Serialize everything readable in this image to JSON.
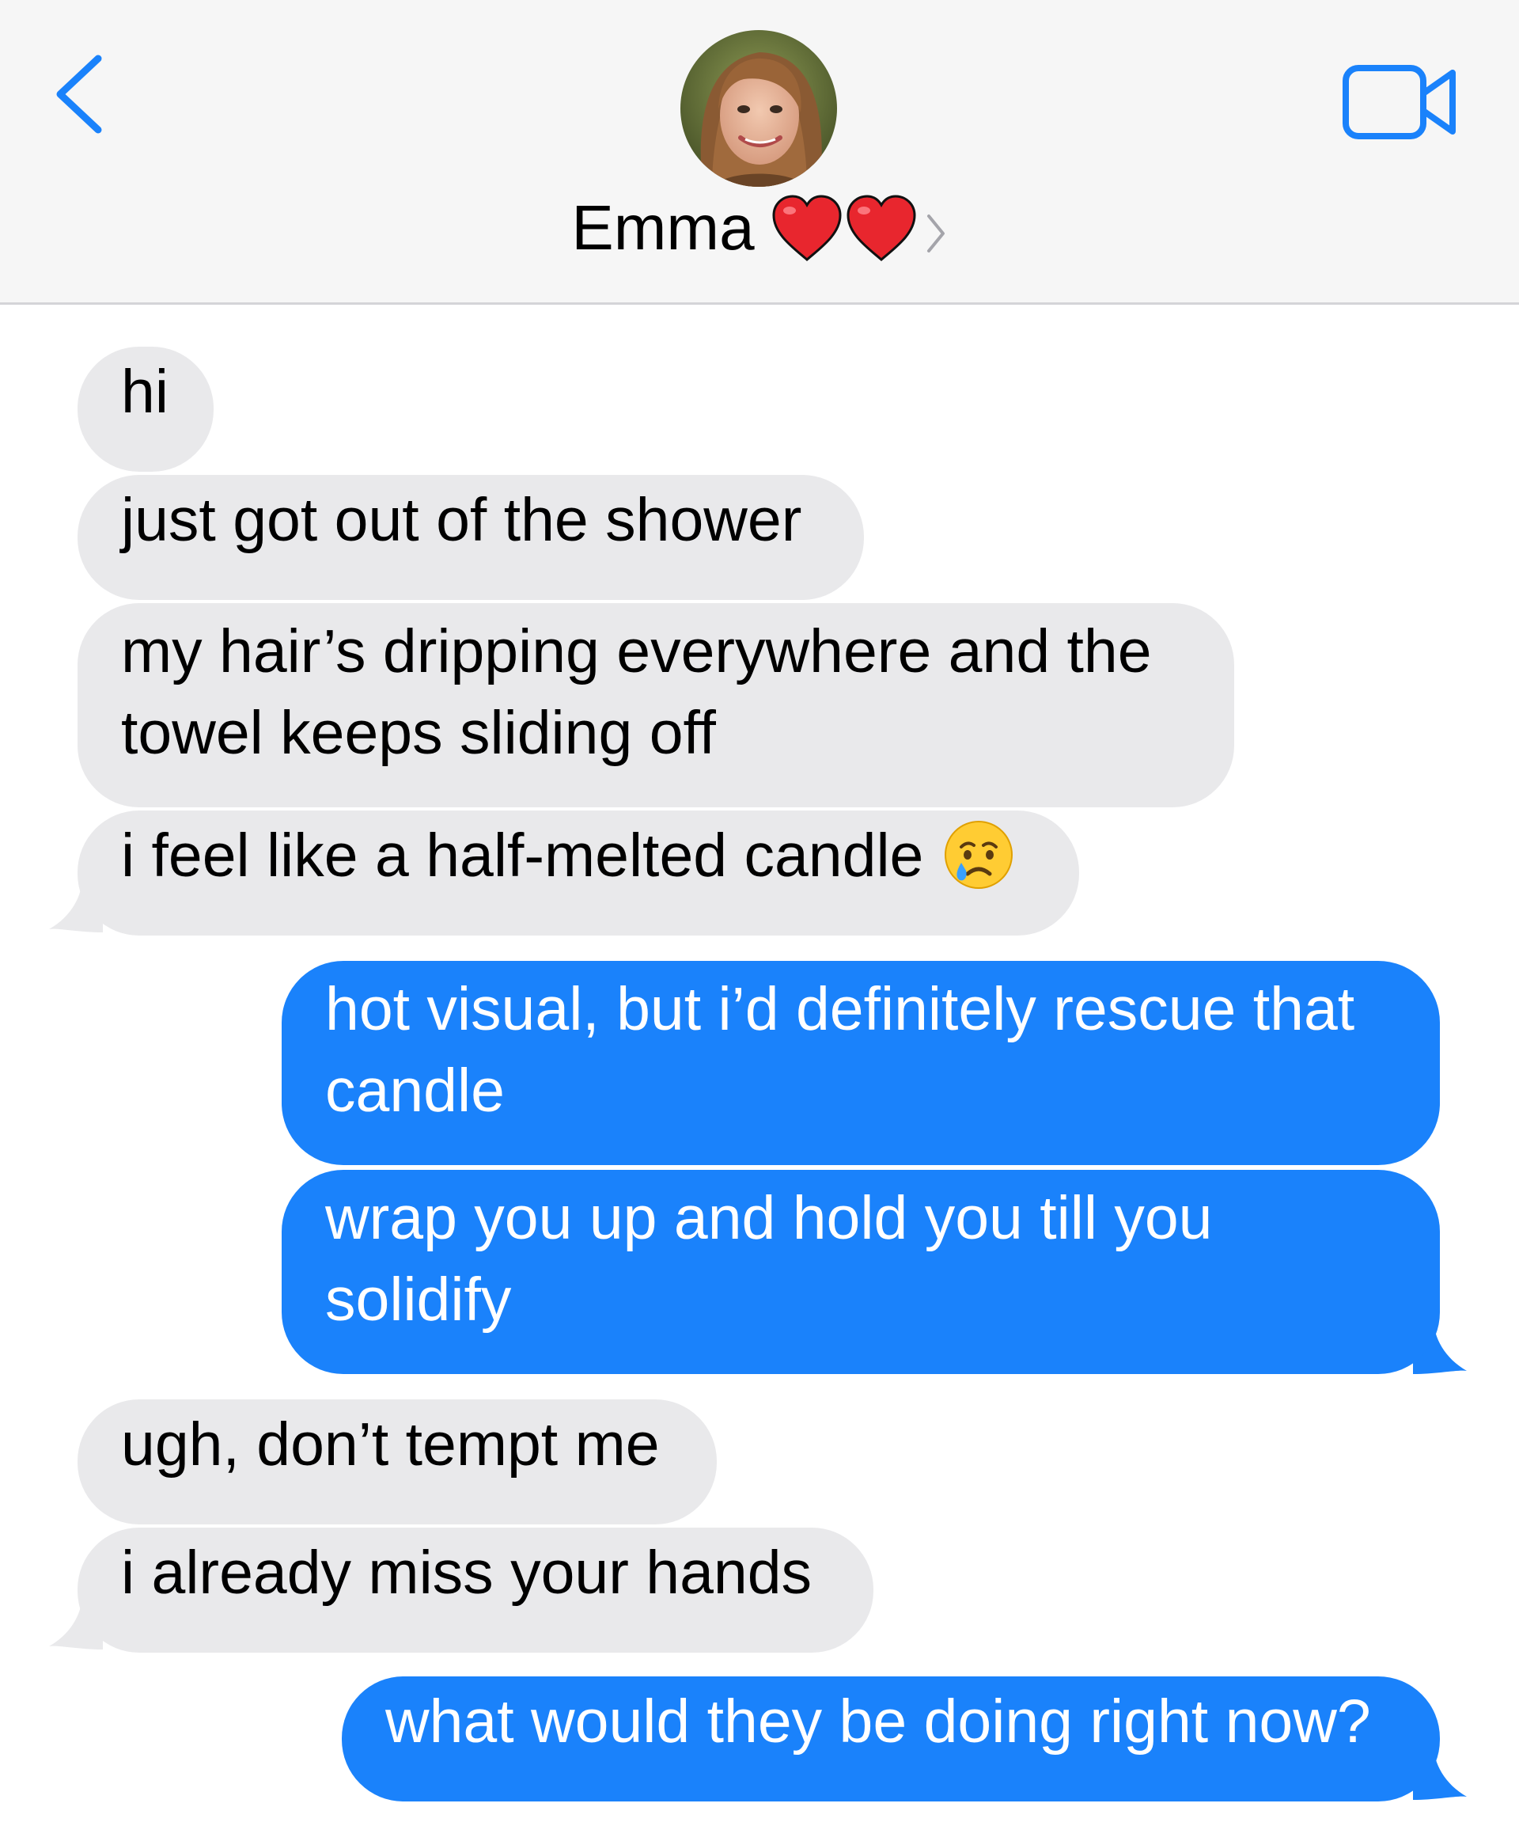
{
  "header": {
    "contact_name": "Emma",
    "avatar_icon": "contact-photo",
    "back_icon": "chevron-left-icon",
    "video_icon": "video-camera-icon",
    "name_suffix_icons": [
      "red-heart-icon",
      "red-heart-icon",
      "chevron-right-icon"
    ]
  },
  "colors": {
    "accent": "#1a82fb",
    "incoming_bubble": "#e9e9eb",
    "header_bg": "#f6f6f6",
    "heart": "#e8262e"
  },
  "messages": [
    {
      "direction": "incoming",
      "lines": [
        "hi"
      ]
    },
    {
      "direction": "incoming",
      "lines": [
        "just got out of the shower"
      ]
    },
    {
      "direction": "incoming",
      "lines": [
        "my hair’s dripping everywhere and the",
        "towel keeps sliding off"
      ]
    },
    {
      "direction": "incoming",
      "lines": [
        "i feel like a half-melted candle"
      ],
      "emoji": "crying-face-icon"
    },
    {
      "direction": "outgoing",
      "lines": [
        "hot visual, but i’d definitely rescue that",
        "candle"
      ]
    },
    {
      "direction": "outgoing",
      "lines": [
        "wrap you up and hold you till you",
        "solidify"
      ]
    },
    {
      "direction": "incoming",
      "lines": [
        "ugh, don’t tempt me"
      ]
    },
    {
      "direction": "incoming",
      "lines": [
        "i already miss your hands"
      ]
    },
    {
      "direction": "outgoing",
      "lines": [
        "what would they be doing right now?"
      ]
    }
  ]
}
